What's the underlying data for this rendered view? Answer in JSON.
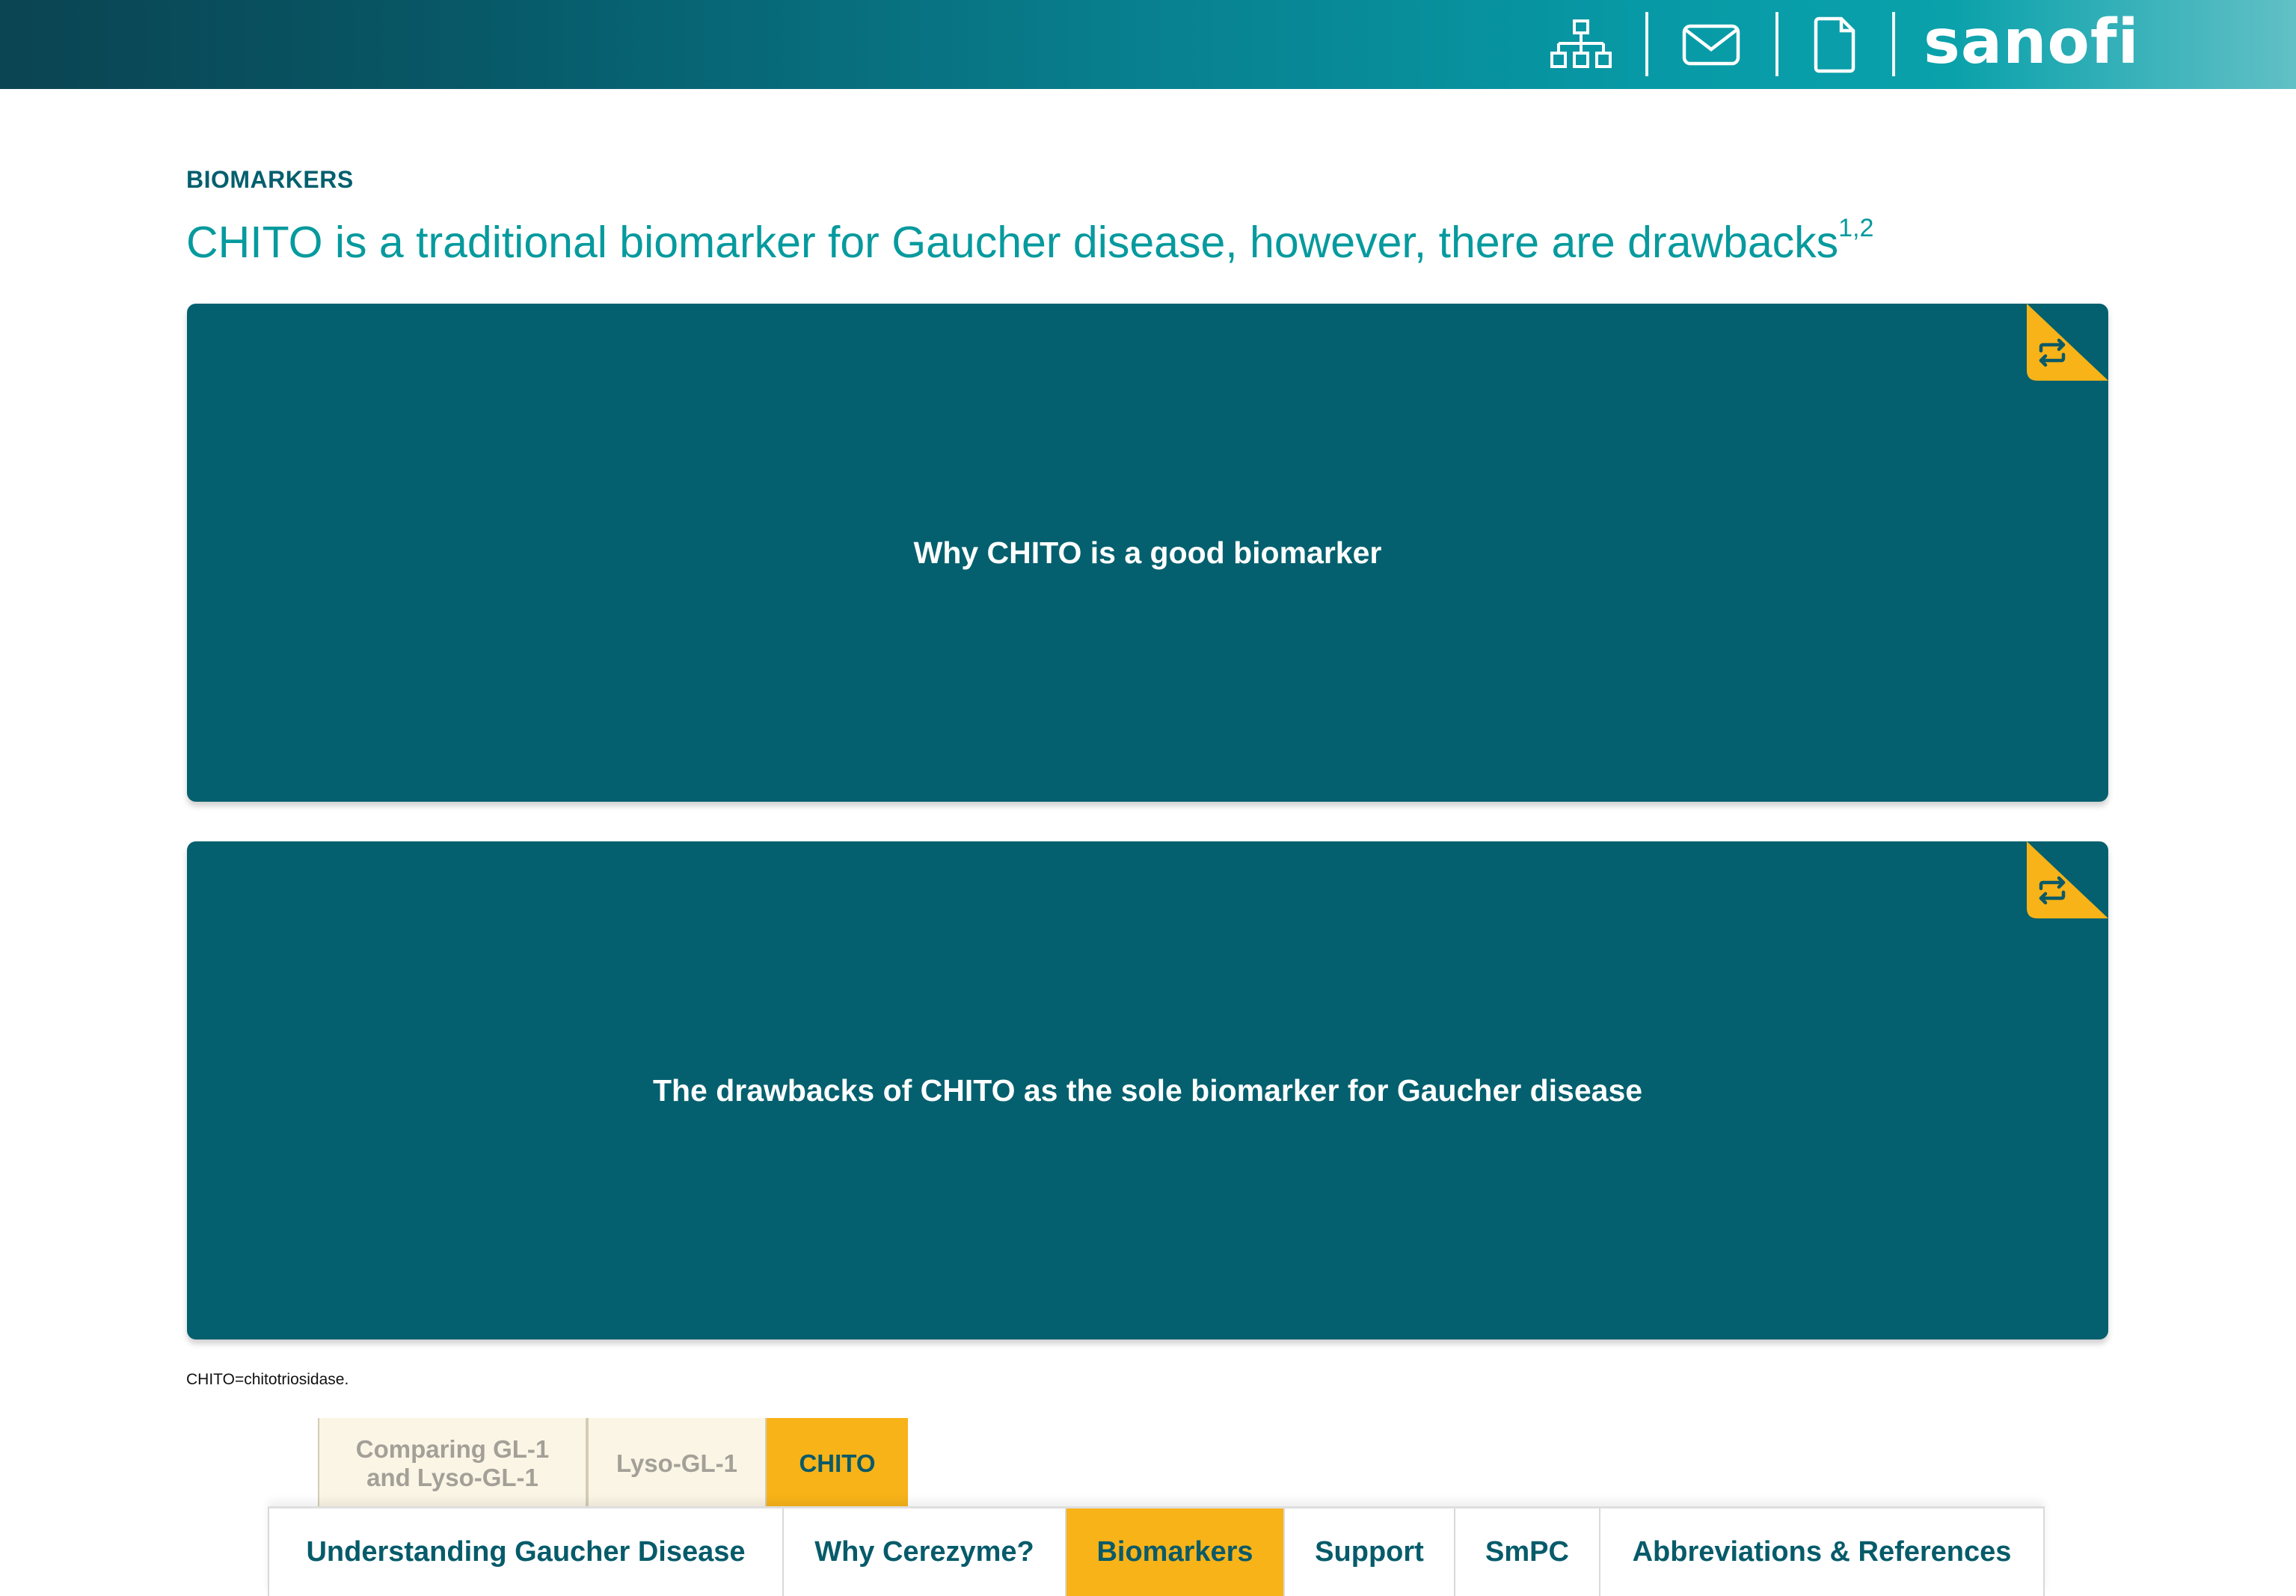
{
  "header": {
    "icons": [
      "sitemap-icon",
      "mail-icon",
      "document-icon"
    ],
    "logo_text": "sanofi",
    "gradient": [
      "#0b4452",
      "#08808f",
      "#61c0c6"
    ]
  },
  "page": {
    "section_label": "BIOMARKERS",
    "title": "CHITO is a traditional biomarker for Gaucher disease, however, there are drawbacks",
    "title_refs": "1,2"
  },
  "cards": [
    {
      "title": "Why CHITO is a good biomarker",
      "icon": "flip-icon"
    },
    {
      "title": "The drawbacks of CHITO as the sole biomarker for Gaucher disease",
      "icon": "flip-icon"
    }
  ],
  "footnote": "CHITO=chitotriosidase.",
  "sub_tabs": [
    {
      "label": "Comparing GL-1 and Lyso-GL-1",
      "active": false
    },
    {
      "label": "Lyso-GL-1",
      "active": false
    },
    {
      "label": "CHITO",
      "active": true
    }
  ],
  "main_nav": [
    {
      "label": "Understanding Gaucher Disease",
      "active": false
    },
    {
      "label": "Why Cerezyme?",
      "active": false
    },
    {
      "label": "Biomarkers",
      "active": true
    },
    {
      "label": "Support",
      "active": false
    },
    {
      "label": "SmPC",
      "active": false
    },
    {
      "label": "Abbreviations & References",
      "active": false
    }
  ],
  "colors": {
    "card": "#04606e",
    "accent": "#f7b318",
    "title": "#069a9e",
    "label": "#035f6e"
  }
}
